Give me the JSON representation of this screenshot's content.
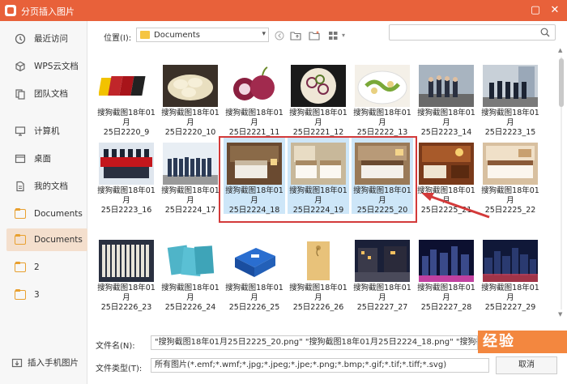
{
  "window": {
    "title": "分页插入图片",
    "restore_symbol": "▢",
    "close_symbol": "✕",
    "accent_color": "#e8613a"
  },
  "sidebar": {
    "items": [
      {
        "label": "最近访问",
        "icon": "clock-icon",
        "active": false
      },
      {
        "label": "WPS云文档",
        "icon": "cloud-cube-icon",
        "active": false
      },
      {
        "label": "团队文档",
        "icon": "team-doc-icon",
        "active": false
      },
      {
        "label": "计算机",
        "icon": "computer-icon",
        "active": false
      },
      {
        "label": "桌面",
        "icon": "desktop-icon",
        "active": false
      },
      {
        "label": "我的文档",
        "icon": "my-documents-icon",
        "active": false
      },
      {
        "label": "Documents",
        "icon": "folder-icon",
        "active": false
      },
      {
        "label": "Documents",
        "icon": "folder-icon",
        "active": true
      },
      {
        "label": "2",
        "icon": "folder-icon",
        "active": false
      },
      {
        "label": "3",
        "icon": "folder-icon",
        "active": false
      }
    ],
    "phone_label": "插入手机图片"
  },
  "toolbar": {
    "location_label": "位置(I):",
    "location_value": "Documents",
    "search_placeholder": ""
  },
  "files": [
    {
      "name1": "搜狗截图18年01月",
      "name2": "25日2220_9",
      "thumb": "red-yellow-boards",
      "selected": false
    },
    {
      "name1": "搜狗截图18年01月",
      "name2": "25日2220_10",
      "thumb": "potato-slices",
      "selected": false
    },
    {
      "name1": "搜狗截图18年01月",
      "name2": "25日2221_11",
      "thumb": "onions",
      "selected": false
    },
    {
      "name1": "搜狗截图18年01月",
      "name2": "25日2221_12",
      "thumb": "onion-dish",
      "selected": false
    },
    {
      "name1": "搜狗截图18年01月",
      "name2": "25日2222_13",
      "thumb": "stir-fry",
      "selected": false
    },
    {
      "name1": "搜狗截图18年01月",
      "name2": "25日2223_14",
      "thumb": "staff-group",
      "selected": false
    },
    {
      "name1": "搜狗截图18年01月",
      "name2": "25日2223_15",
      "thumb": "staff-group-2",
      "selected": false
    },
    {
      "name1": "搜狗截图18年01月",
      "name2": "25日2223_16",
      "thumb": "red-banner-team",
      "selected": false
    },
    {
      "name1": "搜狗截图18年01月",
      "name2": "25日2224_17",
      "thumb": "uniform-team",
      "selected": false
    },
    {
      "name1": "搜狗截图18年01月",
      "name2": "25日2224_18",
      "thumb": "hotel-room-1",
      "selected": true
    },
    {
      "name1": "搜狗截图18年01月",
      "name2": "25日2224_19",
      "thumb": "hotel-room-2",
      "selected": true
    },
    {
      "name1": "搜狗截图18年01月",
      "name2": "25日2225_20",
      "thumb": "hotel-room-3",
      "selected": true
    },
    {
      "name1": "搜狗截图18年01月",
      "name2": "25日2225_21",
      "thumb": "hotel-room-4",
      "selected": false
    },
    {
      "name1": "搜狗截图18年01月",
      "name2": "25日2225_22",
      "thumb": "hotel-room-5",
      "selected": false
    },
    {
      "name1": "搜狗截图18年01月",
      "name2": "25日2226_23",
      "thumb": "archive-shelf",
      "selected": false
    },
    {
      "name1": "搜狗截图18年01月",
      "name2": "25日2226_24",
      "thumb": "blue-booklets",
      "selected": false
    },
    {
      "name1": "搜狗截图18年01月",
      "name2": "25日2226_25",
      "thumb": "blue-box",
      "selected": false
    },
    {
      "name1": "搜狗截图18年01月",
      "name2": "25日2226_26",
      "thumb": "kraft-envelope",
      "selected": false
    },
    {
      "name1": "搜狗截图18年01月",
      "name2": "25日2227_27",
      "thumb": "night-street",
      "selected": false
    },
    {
      "name1": "搜狗截图18年01月",
      "name2": "25日2227_28",
      "thumb": "night-city",
      "selected": false
    },
    {
      "name1": "搜狗截图18年01月",
      "name2": "25日2227_29",
      "thumb": "night-skyline",
      "selected": false
    }
  ],
  "bottom": {
    "filename_label": "文件名(N):",
    "filename_value": "\"搜狗截图18年01月25日2225_20.png\" \"搜狗截图18年01月25日2224_18.png\" \"搜狗截图18年01月25日2",
    "filetype_label": "文件类型(T):",
    "filetype_value": "所有图片(*.emf;*.wmf;*.jpg;*.jpeg;*.jpe;*.png;*.bmp;*.gif;*.tif;*.tiff;*.svg)",
    "cancel_label": "取消",
    "watermark_text": "经验"
  }
}
